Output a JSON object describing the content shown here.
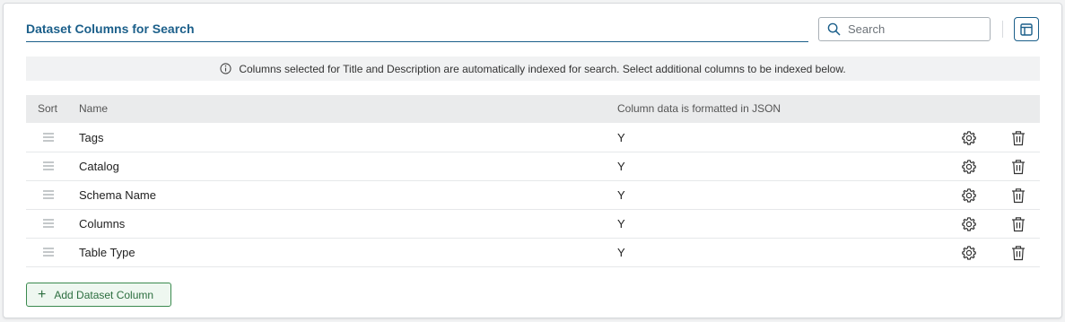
{
  "header": {
    "title": "Dataset Columns for Search",
    "search_placeholder": "Search"
  },
  "info": {
    "text": "Columns selected for Title and Description are automatically indexed for search. Select additional columns to be indexed below."
  },
  "table": {
    "headers": {
      "sort": "Sort",
      "name": "Name",
      "json": "Column data is formatted in JSON"
    },
    "rows": [
      {
        "name": "Tags",
        "json": "Y"
      },
      {
        "name": "Catalog",
        "json": "Y"
      },
      {
        "name": "Schema Name",
        "json": "Y"
      },
      {
        "name": "Columns",
        "json": "Y"
      },
      {
        "name": "Table Type",
        "json": "Y"
      }
    ]
  },
  "actions": {
    "add_icon": "+",
    "add_label": "Add Dataset Column"
  },
  "icons": {
    "search": "search-icon",
    "layout": "layout-icon",
    "info": "info-icon",
    "drag": "drag-handle-icon",
    "settings": "gear-icon",
    "delete": "trash-icon"
  },
  "colors": {
    "accent": "#1b5f8a",
    "add_button": "#2c6e3f"
  }
}
